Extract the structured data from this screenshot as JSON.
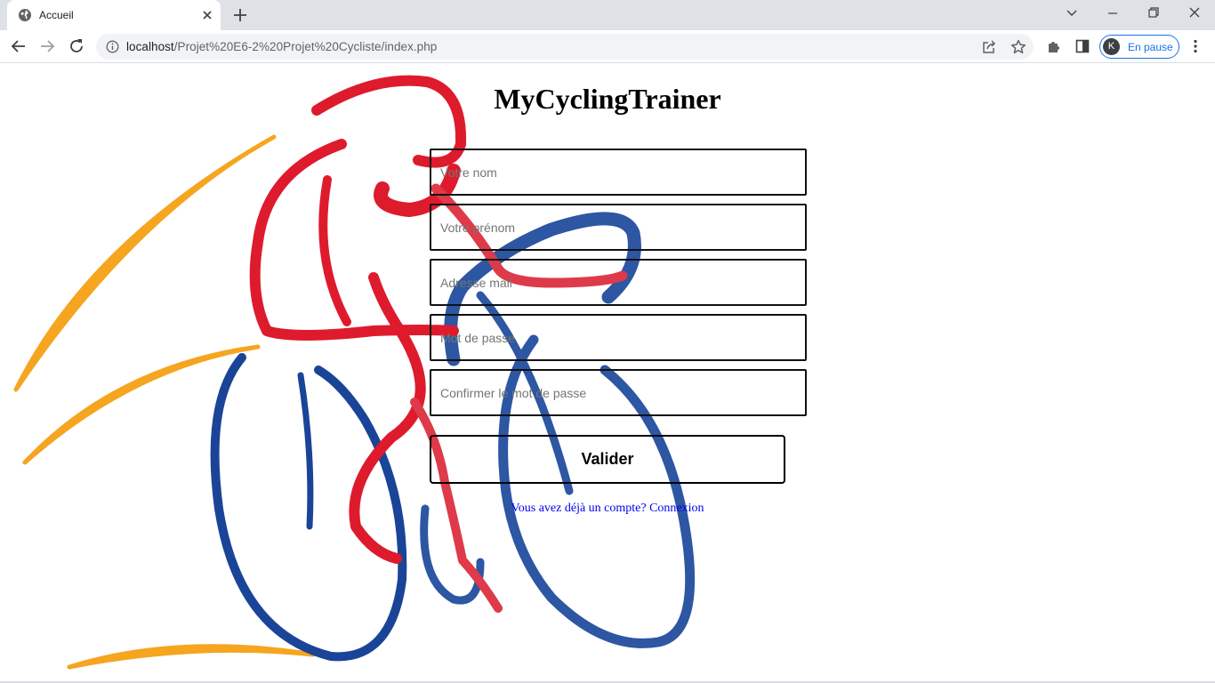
{
  "browser": {
    "tab_title": "Accueil",
    "url_host": "localhost",
    "url_path": "/Projet%20E6-2%20Projet%20Cycliste/index.php",
    "profile_initial": "K",
    "profile_status": "En pause",
    "accent_color": "#1a73e8"
  },
  "page": {
    "title": "MyCyclingTrainer",
    "form": {
      "fields": [
        {
          "placeholder": "Votre nom",
          "value": ""
        },
        {
          "placeholder": "Votre prénom",
          "value": ""
        },
        {
          "placeholder": "Adresse mail",
          "value": ""
        },
        {
          "placeholder": "Mot de passe",
          "value": ""
        },
        {
          "placeholder": "Confirmer le mot de passe",
          "value": ""
        }
      ],
      "submit_label": "Valider"
    },
    "login_prompt": "Vous avez déjà un compte? Connexion",
    "illustration_colors": {
      "red": "#de1b2c",
      "blue": "#1a4497",
      "orange": "#f5a51f"
    }
  }
}
